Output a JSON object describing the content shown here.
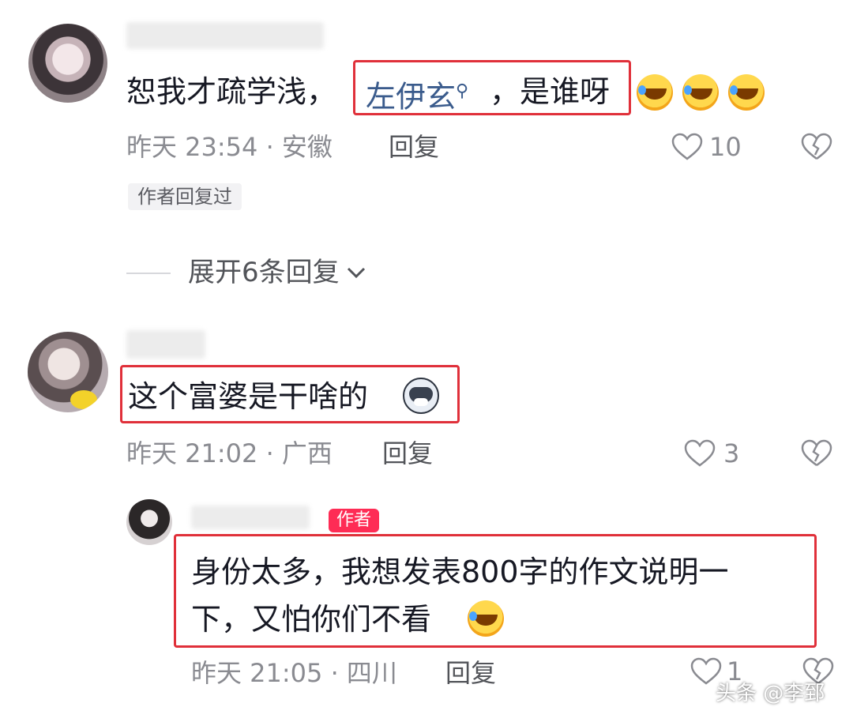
{
  "comments": [
    {
      "text_prefix": "恕我才疏学浅，",
      "link_text": "左伊玄",
      "text_suffix": "，是谁呀",
      "time": "昨天 23:54 · 安徽",
      "reply_label": "回复",
      "likes": "10",
      "author_tag": "作者回复过",
      "expand_label": "展开6条回复"
    },
    {
      "text": "这个富婆是干啥的",
      "time": "昨天 21:02 · 广西",
      "reply_label": "回复",
      "likes": "3"
    }
  ],
  "reply": {
    "author_badge": "作者",
    "text_line1": "身份太多，我想发表800字的作文说明一",
    "text_line2": "下，又怕你们不看",
    "time": "昨天 21:05 · 四川",
    "reply_label": "回复",
    "likes": "1"
  },
  "watermark": "头条 @李郅"
}
